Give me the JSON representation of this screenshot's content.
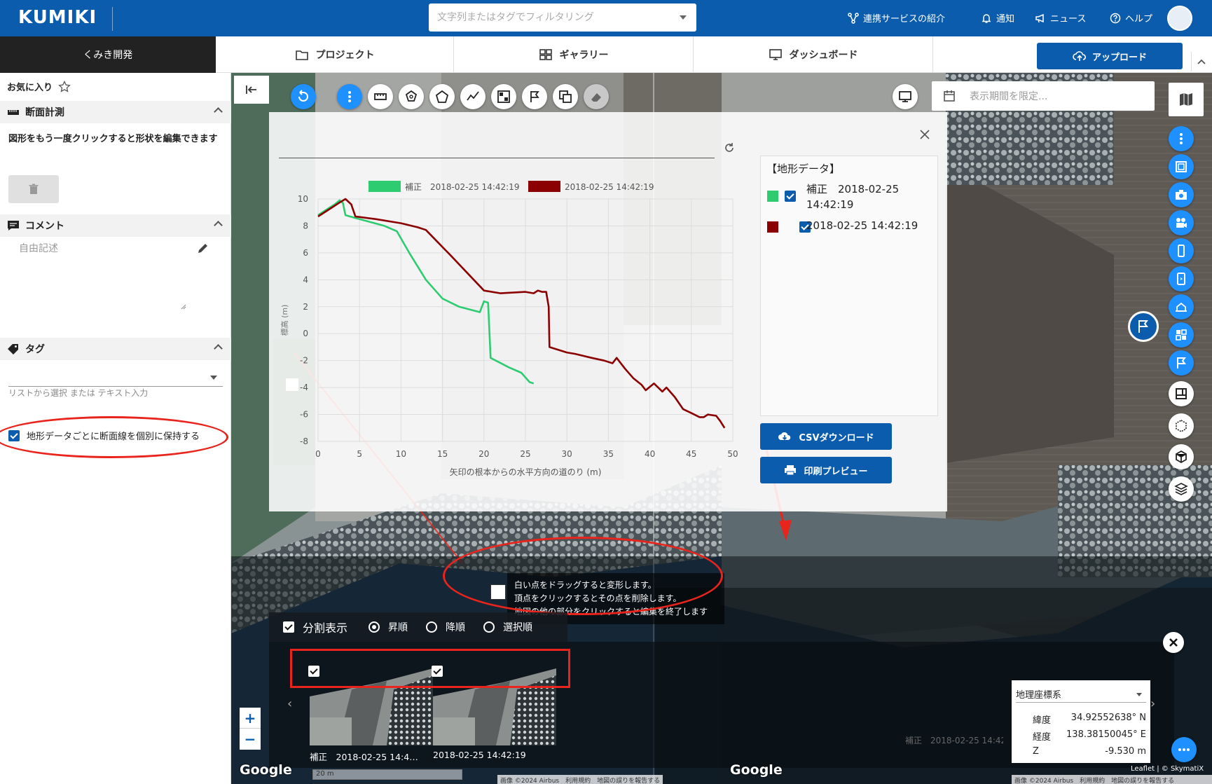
{
  "header": {
    "logo": "KUMIKI",
    "search_placeholder": "文字列またはタグでフィルタリング",
    "nav": {
      "services": "連携サービスの紹介",
      "notify": "通知",
      "news": "ニュース",
      "help": "ヘルプ"
    }
  },
  "tabs": {
    "breadcrumb": "くみき開発",
    "project": "プロジェクト",
    "gallery": "ギャラリー",
    "dashboard": "ダッシュボード",
    "upload": "アップロード"
  },
  "sidebar": {
    "favorite": "お気に入り",
    "section_measure": "断面計測",
    "measure_hint": "図形をもう一度クリックすると形状を編集できます",
    "section_comment": "コメント",
    "comment_placeholder": "自由記述",
    "section_tag": "タグ",
    "tag_placeholder": "リストから選択 または テキスト入力",
    "keep_lines_label": "地形データごとに断面線を個別に保持する"
  },
  "map": {
    "period_placeholder": "表示期間を限定...",
    "split_view": "分割表示",
    "asc": "昇順",
    "desc": "降順",
    "select_order": "選択順",
    "thumb1_label": "補正　2018-02-25 14:4…",
    "thumb2_label": "2018-02-25 14:42:19",
    "tip_line1": "白い点をドラッグすると変形します。",
    "tip_line2": "頂点をクリックするとその点を削除します。",
    "tip_line3": "地図の他の部分をクリックすると編集を終了します",
    "zoom_in": "+",
    "zoom_out": "−",
    "google_left": "Google",
    "google_right": "Google",
    "scale": "20 m",
    "attribution_left": "画像 ©2024 Airbus　利用規約　地図の誤りを報告する",
    "attribution_right": "画像 ©2024 Airbus　利用規約　地図の誤りを報告する",
    "leaflet": "Leaflet | © SkymatiX",
    "ghost_label": "補正　2018-02-25 14:42"
  },
  "coords": {
    "system": "地理座標系",
    "lat_label": "緯度",
    "lat": "34.92552638° N",
    "lon_label": "経度",
    "lon": "138.38150045° E",
    "z_label": "Z",
    "z": "-9.530 m"
  },
  "panel": {
    "legend_title": "【地形データ】",
    "legend_item1_line1": "補正　2018-02-25",
    "legend_item1_line2": "14:42:19",
    "legend_item2": "2018-02-25 14:42:19",
    "csv": "CSVダウンロード",
    "print": "印刷プレビュー"
  },
  "colors": {
    "brand": "#0b5cad",
    "series_green": "#2ecc71",
    "series_red": "#8b0000",
    "annotation": "#e8241c"
  },
  "chart_data": {
    "type": "line",
    "xlabel": "矢印の根本からの水平方向の道のり (m)",
    "ylabel": "標高 (m)",
    "xlim": [
      0,
      50
    ],
    "ylim": [
      -8,
      10
    ],
    "xticks": [
      0,
      5,
      10,
      15,
      20,
      25,
      30,
      35,
      40,
      45,
      50
    ],
    "yticks": [
      10,
      8,
      6,
      4,
      2,
      0,
      -2,
      -4,
      -6,
      -8
    ],
    "grid": true,
    "legend_position": "top",
    "series": [
      {
        "name": "補正　2018-02-25 14:42:19",
        "color": "#2ecc71",
        "points": [
          [
            0,
            8.8
          ],
          [
            1,
            9.2
          ],
          [
            2,
            9.6
          ],
          [
            2.6,
            9.9
          ],
          [
            3,
            9.7
          ],
          [
            3.3,
            8.8
          ],
          [
            5,
            8.5
          ],
          [
            8,
            8.0
          ],
          [
            9.5,
            7.6
          ],
          [
            11,
            6.0
          ],
          [
            13,
            4.0
          ],
          [
            15,
            2.6
          ],
          [
            17,
            2.0
          ],
          [
            19.5,
            1.6
          ],
          [
            20,
            2.4
          ],
          [
            20.5,
            2.3
          ],
          [
            20.8,
            -1.8
          ],
          [
            23,
            -2.5
          ],
          [
            24.5,
            -2.9
          ],
          [
            25.5,
            -3.6
          ],
          [
            26,
            -3.7
          ]
        ]
      },
      {
        "name": "2018-02-25 14:42:19",
        "color": "#8b0000",
        "points": [
          [
            0,
            8.7
          ],
          [
            1.5,
            9.3
          ],
          [
            2.5,
            9.7
          ],
          [
            3.3,
            10.0
          ],
          [
            4,
            9.6
          ],
          [
            4.5,
            8.7
          ],
          [
            7,
            8.5
          ],
          [
            10,
            8.2
          ],
          [
            12,
            7.9
          ],
          [
            13,
            7.7
          ],
          [
            16,
            5.8
          ],
          [
            18,
            4.5
          ],
          [
            20,
            3.2
          ],
          [
            22,
            3.0
          ],
          [
            25,
            3.1
          ],
          [
            26,
            3.0
          ],
          [
            26.5,
            3.2
          ],
          [
            27,
            3.1
          ],
          [
            27.5,
            3.1
          ],
          [
            27.8,
            2.0
          ],
          [
            27.9,
            -1.0
          ],
          [
            30,
            -1.4
          ],
          [
            31,
            -1.5
          ],
          [
            33,
            -1.8
          ],
          [
            34.5,
            -2.0
          ],
          [
            35.5,
            -2.2
          ],
          [
            36,
            -1.8
          ],
          [
            37,
            -2.6
          ],
          [
            38,
            -3.3
          ],
          [
            39,
            -3.8
          ],
          [
            39.5,
            -4.2
          ],
          [
            40.5,
            -3.7
          ],
          [
            41.5,
            -4.3
          ],
          [
            42,
            -4.0
          ],
          [
            43,
            -4.7
          ],
          [
            44,
            -5.6
          ],
          [
            45,
            -5.9
          ],
          [
            46,
            -6.2
          ],
          [
            46.5,
            -6.2
          ],
          [
            47,
            -6.0
          ],
          [
            48,
            -6.1
          ],
          [
            48.5,
            -6.5
          ],
          [
            49,
            -7.0
          ]
        ]
      }
    ]
  }
}
